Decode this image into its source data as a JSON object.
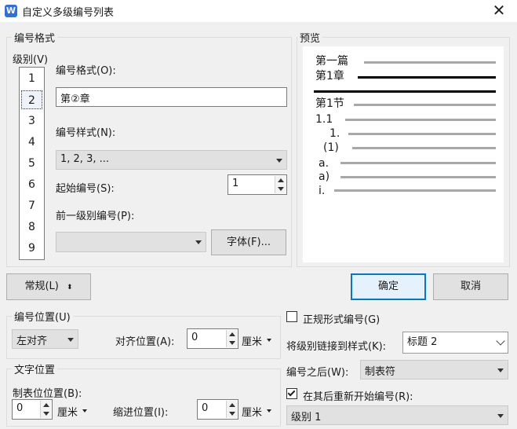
{
  "window": {
    "app_icon": "W",
    "title": "自定义多级编号列表",
    "close_icon": "close-icon"
  },
  "number_format_group": {
    "label": "编号格式",
    "level_label": "级别(V)",
    "levels": [
      "1",
      "2",
      "3",
      "4",
      "5",
      "6",
      "7",
      "8",
      "9"
    ],
    "selected_level": "2",
    "format_label": "编号格式(O):",
    "format_value": "第②章",
    "style_label": "编号样式(N):",
    "style_value": "1, 2, 3, ...",
    "start_label": "起始编号(S):",
    "start_value": "1",
    "prev_level_label": "前一级别编号(P):",
    "prev_level_value": "",
    "font_button": "字体(F)..."
  },
  "preview": {
    "label": "预览",
    "lines": [
      "第一篇",
      "第1章",
      "第1节",
      "1.1",
      "1.",
      "(1)",
      "a.",
      "a)",
      "i."
    ]
  },
  "general_button": "常规(L)",
  "ok_button": "确定",
  "cancel_button": "取消",
  "number_position_group": {
    "label": "编号位置(U)",
    "align_value": "左对齐",
    "align_pos_label": "对齐位置(A):",
    "align_pos_value": "0",
    "align_pos_unit": "厘米"
  },
  "text_position_group": {
    "label": "文字位置",
    "tab_label": "制表位位置(B):",
    "tab_value": "0",
    "tab_unit": "厘米",
    "indent_label": "缩进位置(I):",
    "indent_value": "0",
    "indent_unit": "厘米"
  },
  "right_options": {
    "legal_style_label": "正规形式编号(G)",
    "legal_style_checked": false,
    "link_label": "将级别链接到样式(K):",
    "link_value": "标题 2",
    "after_label": "编号之后(W):",
    "after_value": "制表符",
    "restart_label": "在其后重新开始编号(R):",
    "restart_checked": true,
    "restart_value": "级别 1"
  }
}
